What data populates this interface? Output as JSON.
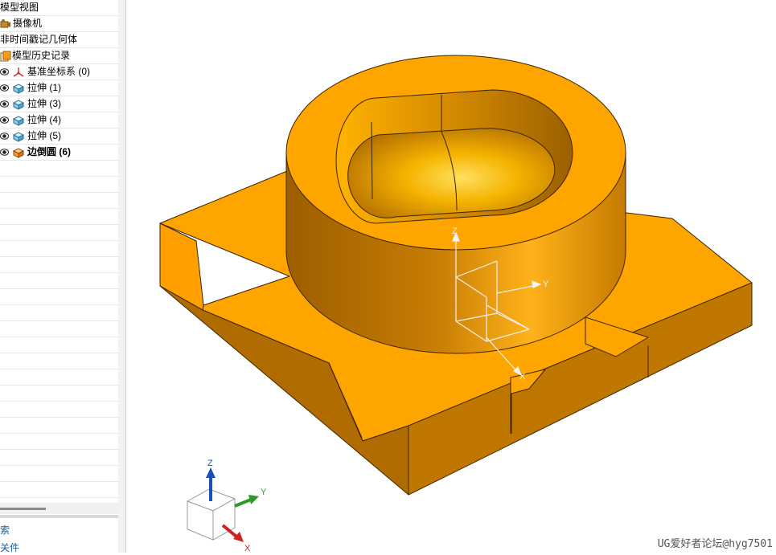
{
  "navigator": {
    "rows": [
      {
        "label": "模型视图",
        "bold": false
      },
      {
        "label": "摄像机",
        "bold": false
      },
      {
        "label": "非时间戳记几何体",
        "bold": false
      },
      {
        "label": "模型历史记录",
        "bold": false
      },
      {
        "label": "基准坐标系 (0)",
        "bold": false
      },
      {
        "label": "拉伸 (1)",
        "bold": false
      },
      {
        "label": "拉伸 (3)",
        "bold": false
      },
      {
        "label": "拉伸 (4)",
        "bold": false
      },
      {
        "label": "拉伸 (5)",
        "bold": false
      },
      {
        "label": "边倒圆 (6)",
        "bold": true
      }
    ],
    "panel_buttons": [
      "索",
      "关件"
    ]
  },
  "viewport": {
    "model_color": "#ffa500",
    "datum_csys_labels": {
      "z": "Z",
      "y": "Y",
      "x": "X"
    },
    "triad_labels": {
      "z": "Z",
      "y": "Y",
      "x": "X"
    }
  },
  "watermark": "UG爱好者论坛@hyg7501"
}
